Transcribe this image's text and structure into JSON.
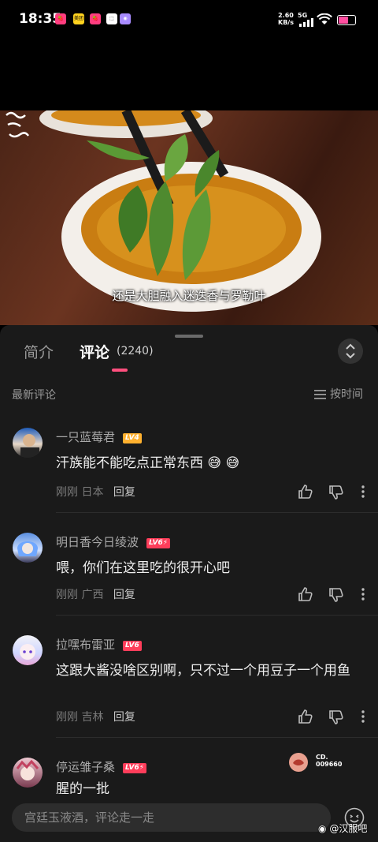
{
  "status_bar": {
    "time": "18:35",
    "net_speed_value": "2.60",
    "net_speed_unit": "KB/s",
    "network": "5G",
    "notifications": [
      {
        "name": "notif-app-1",
        "color": "#ff3d7f",
        "label": "🍓"
      },
      {
        "name": "notif-app-2",
        "color": "#ffd21f",
        "label": "美团"
      },
      {
        "name": "notif-app-3",
        "color": "#ff3d7f",
        "label": "🍓"
      },
      {
        "name": "notif-app-4",
        "color": "#ffffff",
        "label": "⬚"
      },
      {
        "name": "notif-app-5",
        "color": "#a88bff",
        "label": "◉"
      }
    ],
    "battery_level": 0.55
  },
  "video": {
    "subtitle": "还是大胆融入迷迭香与罗勒叶"
  },
  "tabs": {
    "intro": "简介",
    "comments": "评论",
    "comment_count": "(2240)"
  },
  "sort": {
    "latest": "最新评论",
    "by_time": "按时间"
  },
  "comments": [
    {
      "username": "一只蓝莓君",
      "level": "LV4",
      "level_color": "#ffb12f",
      "text": "汗族能不能吃点正常东西 😅 😅",
      "time": "刚刚",
      "location": "日本",
      "reply": "回复"
    },
    {
      "username": "明日香今日绫波",
      "level": "LV6⚡",
      "level_color": "#ff3d5a",
      "text": "喂，你们在这里吃的很开心吧",
      "time": "刚刚",
      "location": "广西",
      "reply": "回复"
    },
    {
      "username": "拉嘿布雷亚",
      "level": "LV6",
      "level_color": "#ff3d5a",
      "text": "这跟大酱没啥区别啊，只不过一个用豆子一个用鱼",
      "time": "刚刚",
      "location": "吉林",
      "reply": "回复"
    },
    {
      "username": "停运雏子桑",
      "level": "LV6⚡",
      "level_color": "#ff3d5a",
      "text": "腥的一批"
    }
  ],
  "float_badge": {
    "line1": "CD.",
    "line2": "009660"
  },
  "input": {
    "placeholder": "宫廷玉液酒，评论走一走"
  },
  "watermark": "@汉服吧",
  "icons": {
    "like": "thumb-up-icon",
    "dislike": "thumb-down-icon",
    "more": "more-vertical-icon",
    "emoji": "emoji-icon"
  },
  "colors": {
    "accent": "#ff4f7e",
    "background": "#1a1a1a"
  }
}
